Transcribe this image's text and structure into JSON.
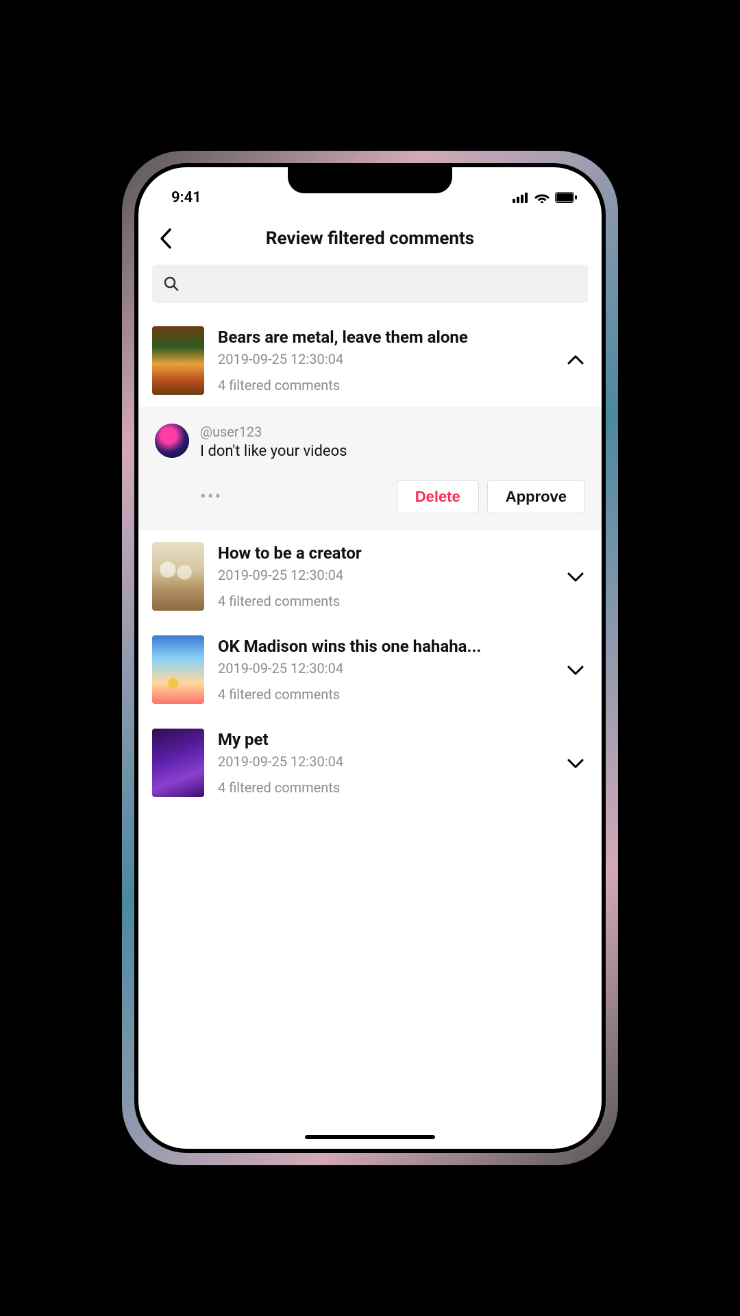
{
  "statusbar": {
    "time": "9:41"
  },
  "header": {
    "title": "Review filtered comments"
  },
  "search": {
    "placeholder": ""
  },
  "videos": [
    {
      "title": "Bears are metal, leave them alone",
      "date": "2019-09-25 12:30:04",
      "filtered": "4 filtered comments",
      "expanded": true,
      "comment": {
        "user": "@user123",
        "text": "I don't like your videos",
        "delete_label": "Delete",
        "approve_label": "Approve"
      }
    },
    {
      "title": "How to be a creator",
      "date": "2019-09-25 12:30:04",
      "filtered": "4 filtered comments",
      "expanded": false
    },
    {
      "title": "OK Madison wins this one hahaha...",
      "date": "2019-09-25 12:30:04",
      "filtered": "4 filtered comments",
      "expanded": false
    },
    {
      "title": "My pet",
      "date": "2019-09-25 12:30:04",
      "filtered": "4 filtered comments",
      "expanded": false
    }
  ],
  "colors": {
    "accent": "#fe2c55",
    "text_secondary": "#8c8c8c"
  }
}
